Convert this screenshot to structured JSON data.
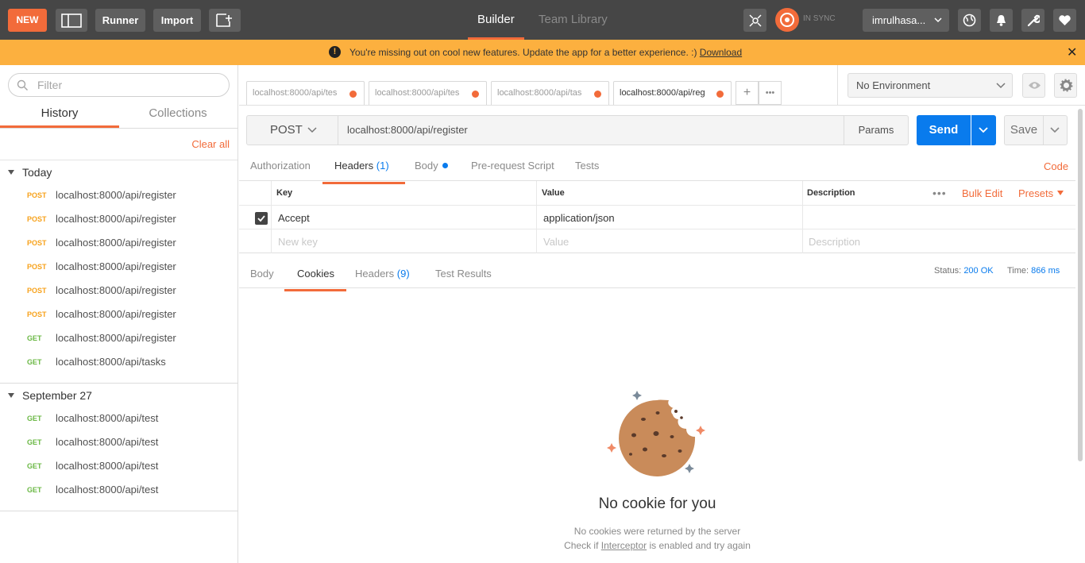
{
  "topbar": {
    "new_label": "NEW",
    "runner_label": "Runner",
    "import_label": "Import",
    "tabs": [
      {
        "label": "Builder",
        "active": true
      },
      {
        "label": "Team Library",
        "active": false
      }
    ],
    "sync_status": "IN SYNC",
    "username": "imrulhasa..."
  },
  "banner": {
    "message": "You're missing out on cool new features. Update the app for a better experience. :) ",
    "link": "Download",
    "warning_glyph": "!",
    "close_glyph": "✕"
  },
  "sidebar": {
    "filter_placeholder": "Filter",
    "tabs": [
      {
        "label": "History",
        "active": true
      },
      {
        "label": "Collections",
        "active": false
      }
    ],
    "clear_all": "Clear all",
    "groups": [
      {
        "title": "Today",
        "items": [
          {
            "method": "POST",
            "url": "localhost:8000/api/register"
          },
          {
            "method": "POST",
            "url": "localhost:8000/api/register"
          },
          {
            "method": "POST",
            "url": "localhost:8000/api/register"
          },
          {
            "method": "POST",
            "url": "localhost:8000/api/register"
          },
          {
            "method": "POST",
            "url": "localhost:8000/api/register"
          },
          {
            "method": "POST",
            "url": "localhost:8000/api/register"
          },
          {
            "method": "GET",
            "url": "localhost:8000/api/register"
          },
          {
            "method": "GET",
            "url": "localhost:8000/api/tasks"
          }
        ]
      },
      {
        "title": "September 27",
        "items": [
          {
            "method": "GET",
            "url": "localhost:8000/api/test"
          },
          {
            "method": "GET",
            "url": "localhost:8000/api/test"
          },
          {
            "method": "GET",
            "url": "localhost:8000/api/test"
          },
          {
            "method": "GET",
            "url": "localhost:8000/api/test"
          }
        ]
      }
    ]
  },
  "request_tabs": [
    {
      "label": "localhost:8000/api/tes",
      "active": false
    },
    {
      "label": "localhost:8000/api/tes",
      "active": false
    },
    {
      "label": "localhost:8000/api/tas",
      "active": false
    },
    {
      "label": "localhost:8000/api/reg",
      "active": true
    }
  ],
  "request_tab_controls": {
    "add_glyph": "+",
    "more_glyph": "•••"
  },
  "environment": {
    "selected": "No Environment"
  },
  "request": {
    "method": "POST",
    "url": "localhost:8000/api/register",
    "params_label": "Params",
    "send_label": "Send",
    "save_label": "Save"
  },
  "request_subtabs": {
    "authorization": "Authorization",
    "headers": "Headers",
    "headers_count": "(1)",
    "body": "Body",
    "prerequest": "Pre-request Script",
    "tests": "Tests",
    "code": "Code"
  },
  "headers_table": {
    "col_key": "Key",
    "col_value": "Value",
    "col_description": "Description",
    "more_glyph": "•••",
    "bulk_edit": "Bulk Edit",
    "presets": "Presets",
    "rows": [
      {
        "checked": true,
        "key": "Accept",
        "value": "application/json",
        "description": ""
      }
    ],
    "new_key_placeholder": "New key",
    "new_value_placeholder": "Value",
    "new_description_placeholder": "Description"
  },
  "response": {
    "tabs": {
      "body": "Body",
      "cookies": "Cookies",
      "headers": "Headers",
      "headers_count": "(9)",
      "test_results": "Test Results"
    },
    "status_label": "Status:",
    "status_value": "200 OK",
    "time_label": "Time:",
    "time_value": "866 ms",
    "empty_title": "No cookie for you",
    "empty_line1": "No cookies were returned by the server",
    "empty_line2_prefix": "Check if ",
    "empty_line2_link": "Interceptor",
    "empty_line2_suffix": " is enabled and try again"
  },
  "colors": {
    "accent": "#f26b3a",
    "send_blue": "#097bed",
    "banner": "#fcb03f",
    "topbar": "#464646",
    "post": "#f7a21b",
    "get": "#6bb845"
  },
  "icons": {
    "sidebar_toggle": "sidebar-toggle-icon",
    "new_window": "new-window-icon",
    "interceptor": "satellite-icon",
    "sync": "sync-icon",
    "globe": "globe-icon",
    "bell": "bell-icon",
    "wrench": "wrench-icon",
    "heart": "heart-icon",
    "eye": "eye-icon",
    "gear": "gear-icon",
    "search": "search-icon"
  }
}
